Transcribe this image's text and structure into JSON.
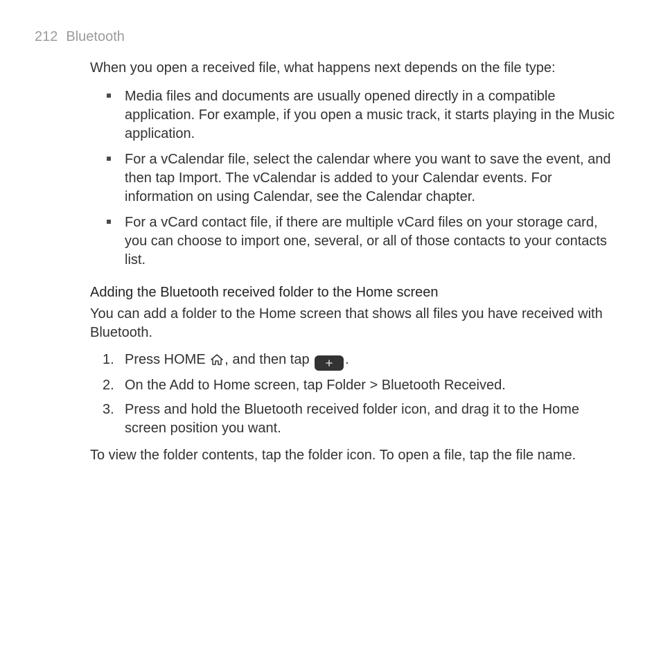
{
  "header": {
    "page_number": "212",
    "section": "Bluetooth"
  },
  "intro": "When you open a received file, what happens next depends on the file type:",
  "bullets": [
    "Media files and documents are usually opened directly in a compatible application. For example, if you open a music track, it starts playing in the Music application.",
    "For a vCalendar file, select the calendar where you want to save the event, and then tap Import. The vCalendar is added to your Calendar events. For information on using Calendar, see the Calendar chapter.",
    "For a vCard contact file, if there are multiple vCard files on your storage card, you can choose to import one, several, or all of those contacts to your contacts list."
  ],
  "section2": {
    "heading": "Adding the Bluetooth received folder to the Home screen",
    "intro": "You can add a folder to the Home screen that shows all files you have received with Bluetooth.",
    "step1_a": "Press HOME ",
    "step1_b": ", and then tap ",
    "step1_c": ".",
    "step2_a": "On the Add to Home screen, tap ",
    "step2_b": "Folder > Bluetooth Received",
    "step2_c": ".",
    "step3": "Press and hold the Bluetooth received folder icon, and drag it to the Home screen position you want.",
    "outro": "To view the folder contents, tap the folder icon. To open a file, tap the file name."
  }
}
